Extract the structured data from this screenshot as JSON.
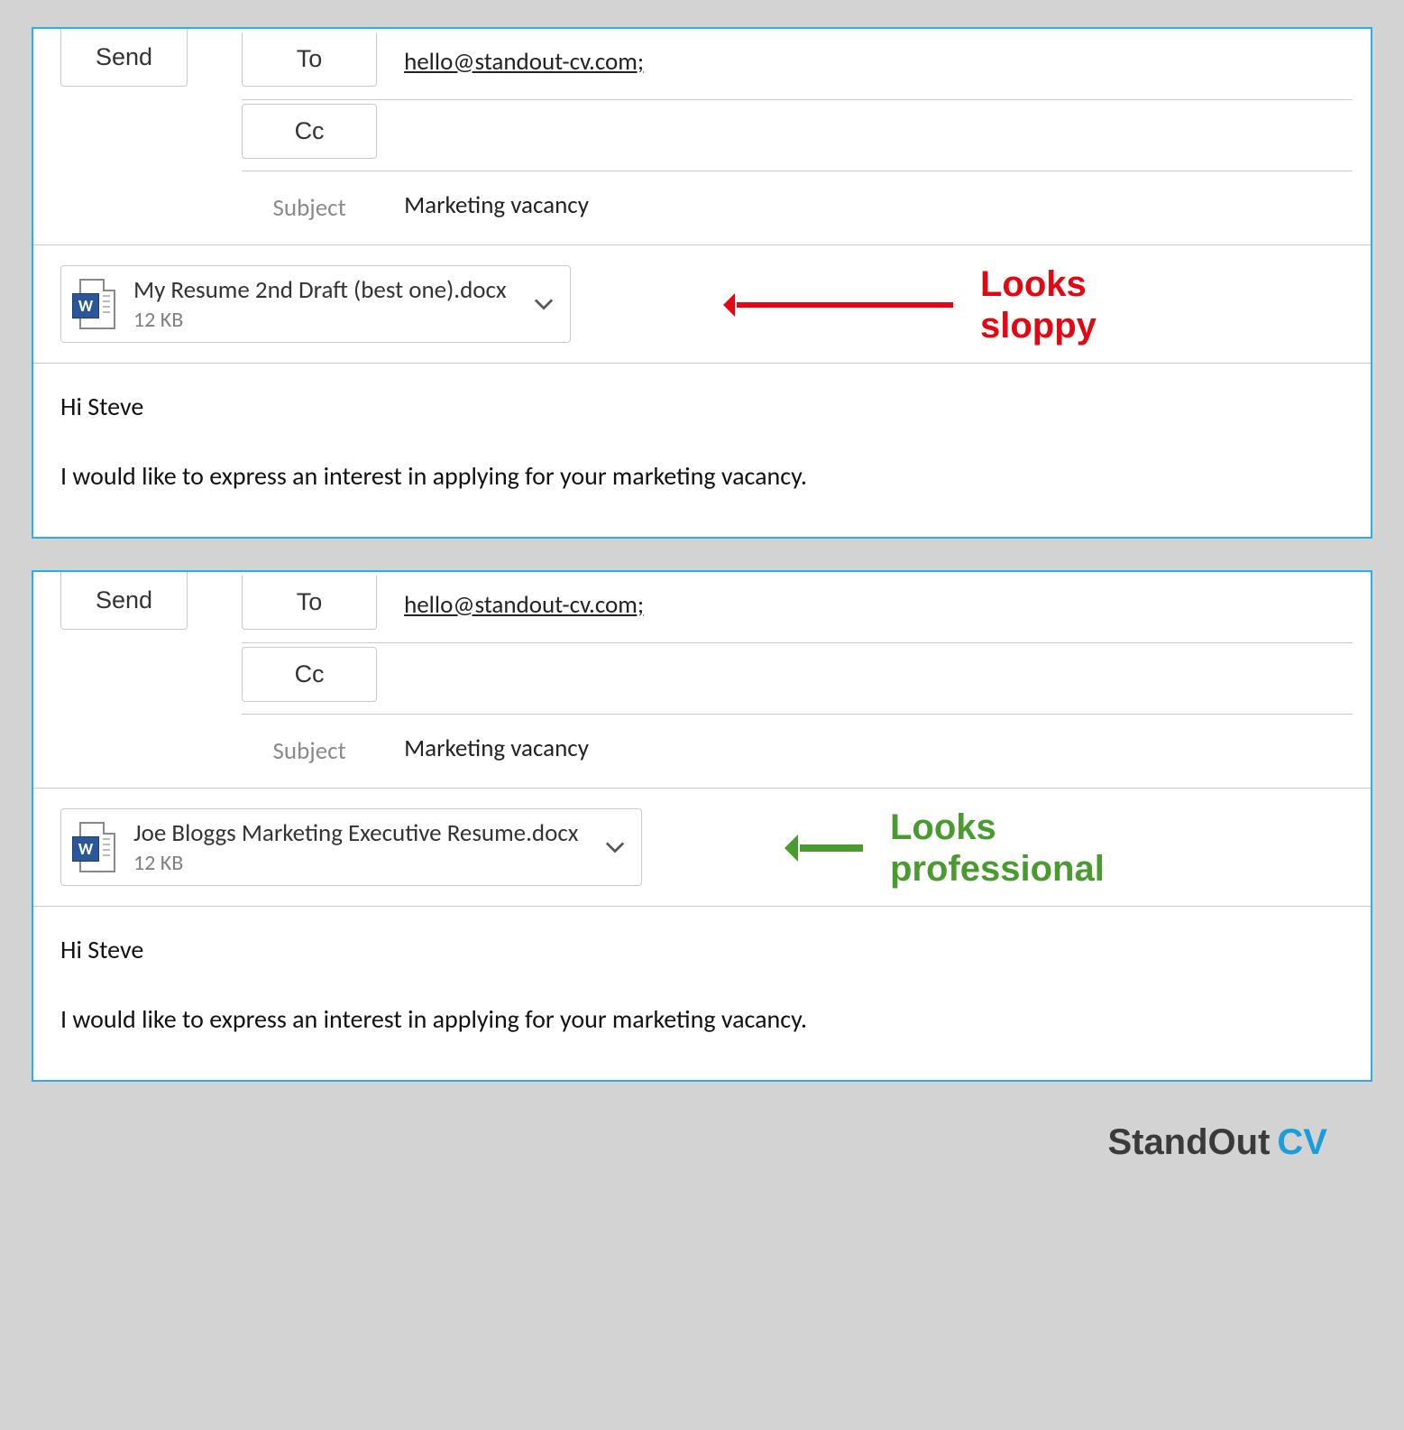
{
  "emails": [
    {
      "send_label": "Send",
      "to_label": "To",
      "to_value": "hello@standout-cv.com;",
      "cc_label": "Cc",
      "cc_value": "",
      "subject_label": "Subject",
      "subject_value": "Marketing vacancy",
      "attachment": {
        "filename": "My Resume 2nd Draft (best one).docx",
        "filesize": "12 KB",
        "icon_letter": "W"
      },
      "body_lines": [
        "Hi Steve",
        "I would like to express an interest in applying for your marketing vacancy."
      ],
      "annotation": {
        "text": "Looks\nsloppy",
        "color": "red"
      }
    },
    {
      "send_label": "Send",
      "to_label": "To",
      "to_value": "hello@standout-cv.com;",
      "cc_label": "Cc",
      "cc_value": "",
      "subject_label": "Subject",
      "subject_value": "Marketing vacancy",
      "attachment": {
        "filename": "Joe Bloggs Marketing Executive Resume.docx",
        "filesize": "12 KB",
        "icon_letter": "W"
      },
      "body_lines": [
        "Hi Steve",
        "I would like to express an interest in applying for your marketing vacancy."
      ],
      "annotation": {
        "text": "Looks\nprofessional",
        "color": "green"
      }
    }
  ],
  "footer": {
    "brand1": "StandOut",
    "brand2": "CV"
  }
}
